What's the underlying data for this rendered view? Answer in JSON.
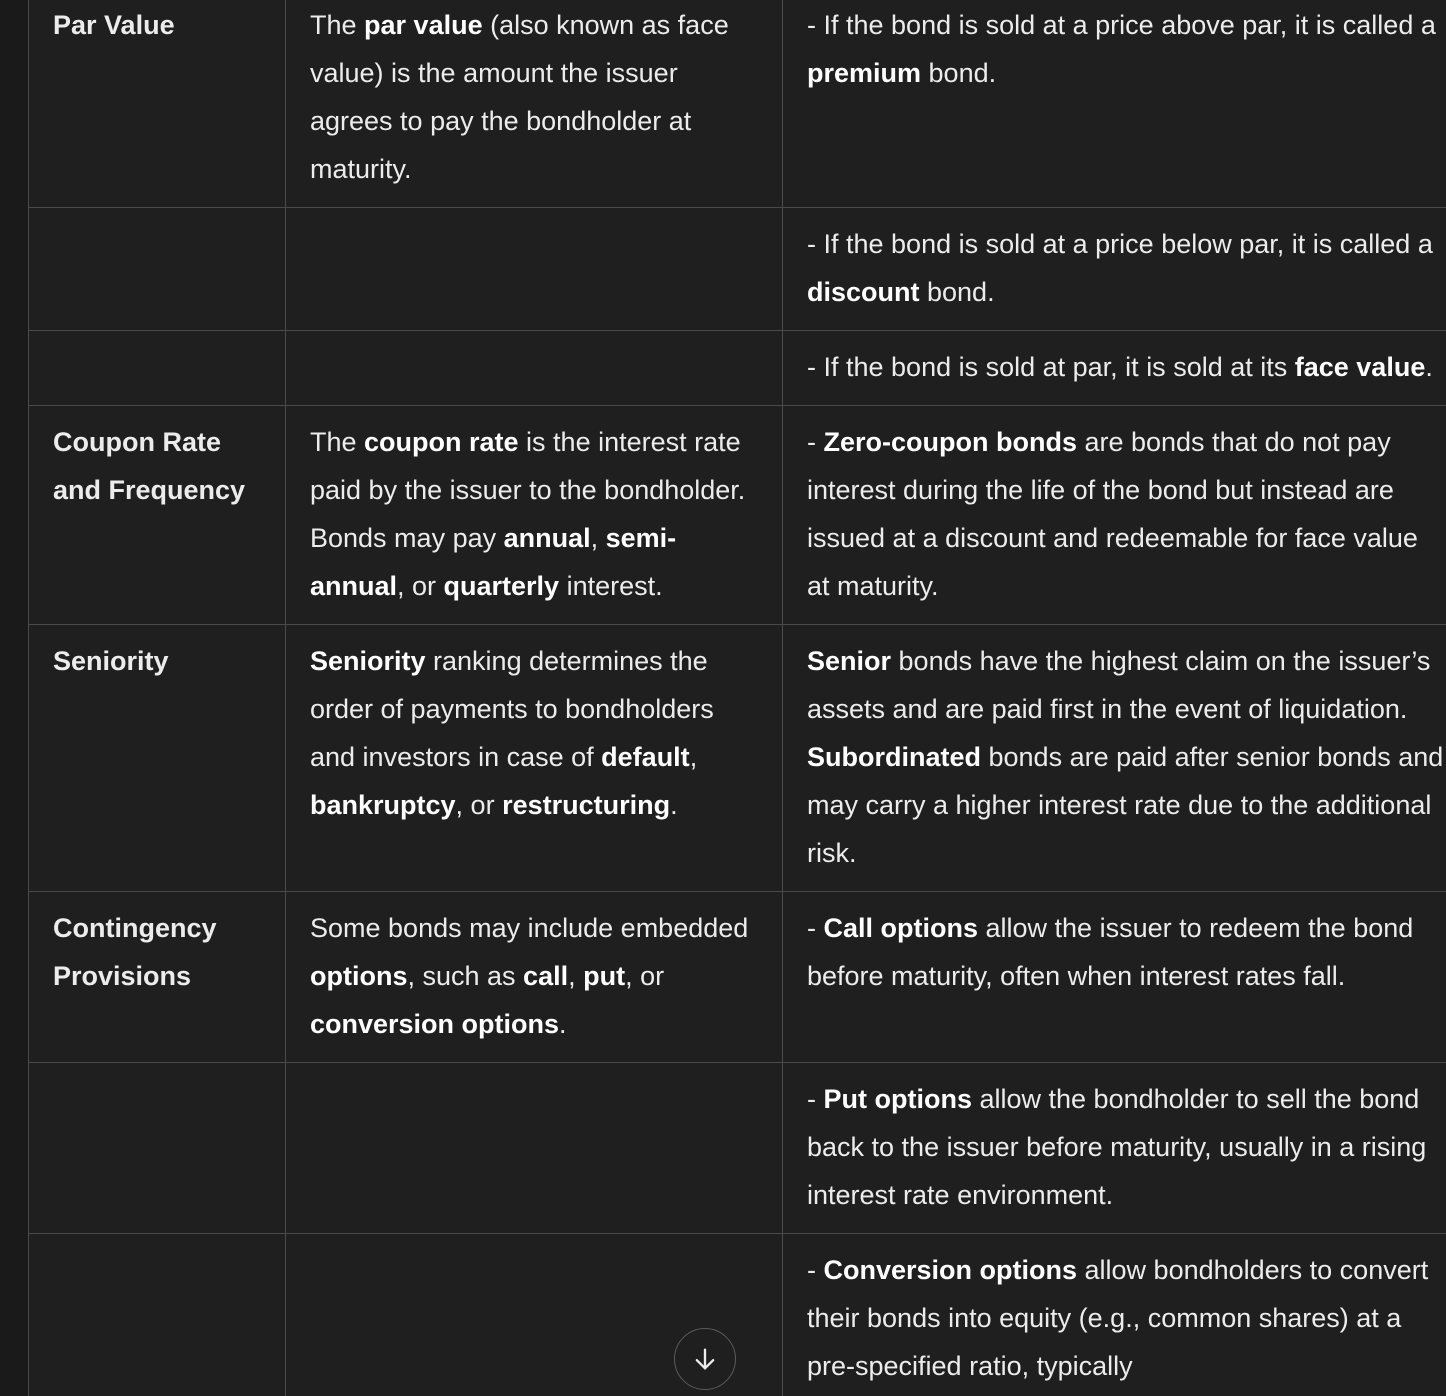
{
  "table": {
    "rows": [
      {
        "label": "Par Value",
        "description": [
          {
            "t": "The "
          },
          {
            "b": "par value"
          },
          {
            "t": " (also known as face value) is the amount the issuer agrees to pay the bondholder at maturity."
          }
        ],
        "notes": [
          {
            "t": "- If the bond is sold at a price above par, it is called a "
          },
          {
            "b": "premium"
          },
          {
            "t": " bond."
          }
        ]
      },
      {
        "label": "",
        "description": [],
        "notes": [
          {
            "t": "- If the bond is sold at a price below par, it is called a "
          },
          {
            "b": "discount"
          },
          {
            "t": " bond."
          }
        ]
      },
      {
        "label": "",
        "description": [],
        "notes": [
          {
            "t": "- If the bond is sold at par, it is sold at its "
          },
          {
            "b": "face value"
          },
          {
            "t": "."
          }
        ]
      },
      {
        "label": "Coupon Rate and Frequency",
        "description": [
          {
            "t": "The "
          },
          {
            "b": "coupon rate"
          },
          {
            "t": " is the interest rate paid by the issuer to the bondholder. Bonds may pay "
          },
          {
            "b": "annual"
          },
          {
            "t": ", "
          },
          {
            "b": "semi-annual"
          },
          {
            "t": ", or "
          },
          {
            "b": "quarterly"
          },
          {
            "t": " interest."
          }
        ],
        "notes": [
          {
            "t": "- "
          },
          {
            "b": "Zero-coupon bonds"
          },
          {
            "t": " are bonds that do not pay interest during the life of the bond but instead are issued at a discount and redeemable for face value at maturity."
          }
        ]
      },
      {
        "label": "Seniority",
        "description": [
          {
            "b": "Seniority"
          },
          {
            "t": " ranking determines the order of payments to bondholders and investors in case of "
          },
          {
            "b": "default"
          },
          {
            "t": ", "
          },
          {
            "b": "bankruptcy"
          },
          {
            "t": ", or "
          },
          {
            "b": "restructuring"
          },
          {
            "t": "."
          }
        ],
        "notes": [
          {
            "b": "Senior"
          },
          {
            "t": " bonds have the highest claim on the issuer’s assets and are paid first in the event of liquidation. "
          },
          {
            "b": "Subordinated"
          },
          {
            "t": " bonds are paid after senior bonds and may carry a higher interest rate due to the additional risk."
          }
        ]
      },
      {
        "label": "Contingency Provisions",
        "description": [
          {
            "t": "Some bonds may include embedded "
          },
          {
            "b": "options"
          },
          {
            "t": ", such as "
          },
          {
            "b": "call"
          },
          {
            "t": ", "
          },
          {
            "b": "put"
          },
          {
            "t": ", or "
          },
          {
            "b": "conversion options"
          },
          {
            "t": "."
          }
        ],
        "notes": [
          {
            "t": "- "
          },
          {
            "b": "Call options"
          },
          {
            "t": " allow the issuer to redeem the bond before maturity, often when interest rates fall."
          }
        ]
      },
      {
        "label": "",
        "description": [],
        "notes": [
          {
            "t": "- "
          },
          {
            "b": "Put options"
          },
          {
            "t": " allow the bondholder to sell the bond back to the issuer before maturity, usually in a rising interest rate environment."
          }
        ]
      },
      {
        "label": "",
        "description": [],
        "notes": [
          {
            "t": "- "
          },
          {
            "b": "Conversion options"
          },
          {
            "t": " allow bondholders to convert their bonds into equity (e.g., common shares) at a pre-specified ratio, typically"
          }
        ]
      }
    ]
  },
  "scroll_button": {
    "icon": "arrow-down-icon"
  }
}
